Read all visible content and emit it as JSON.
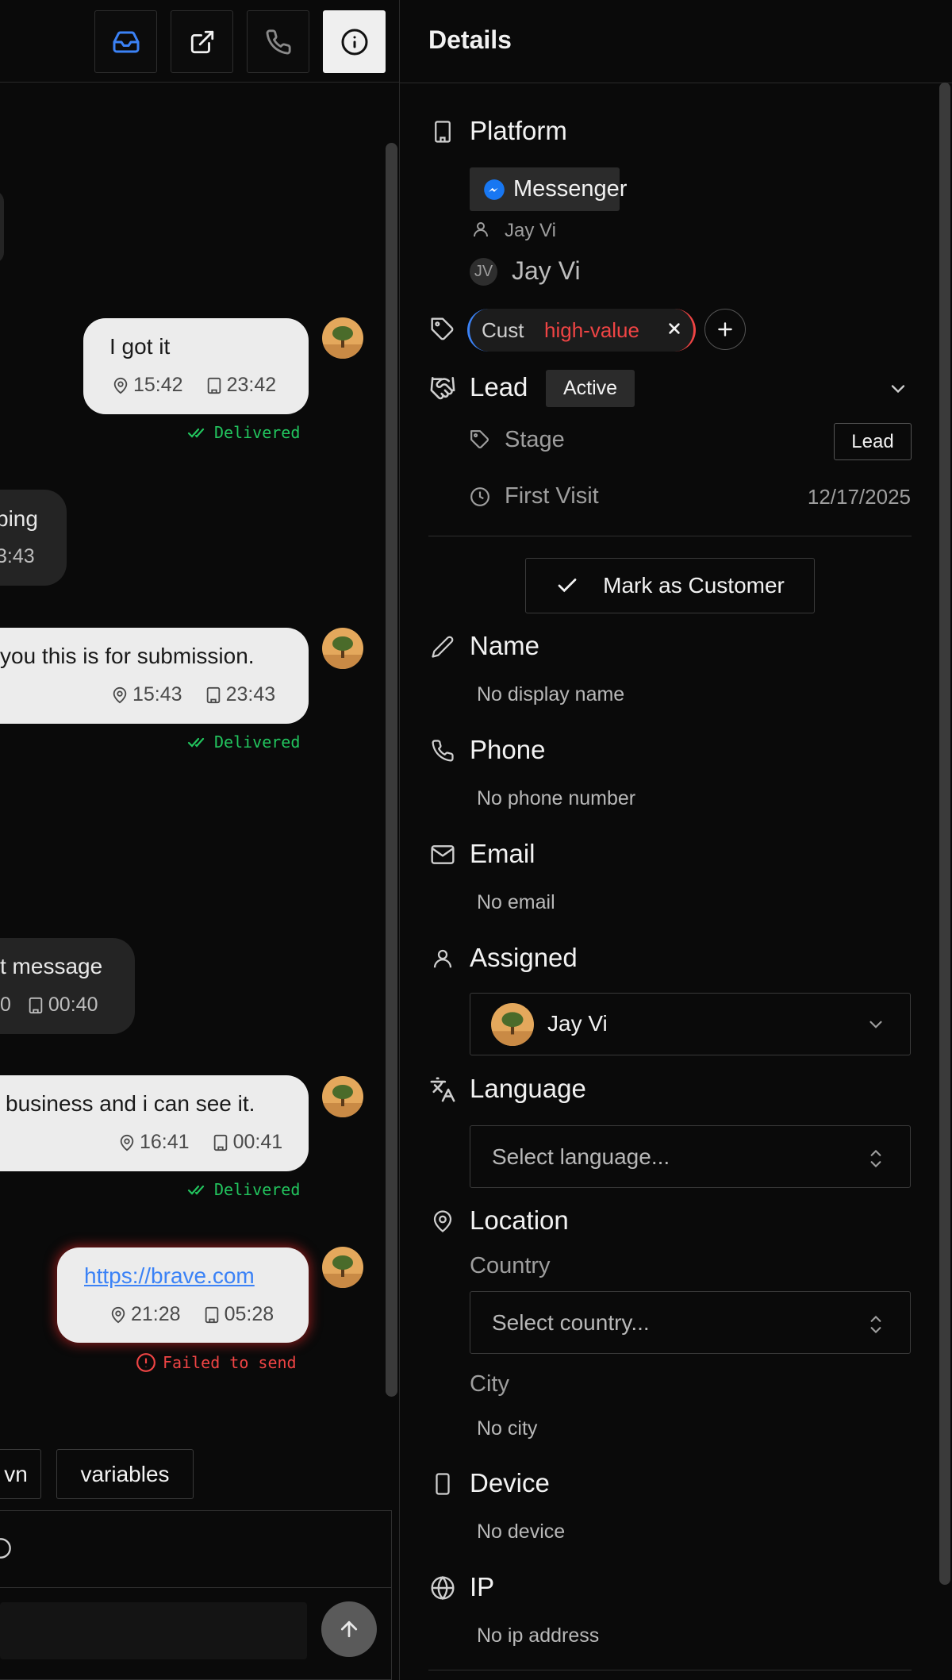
{
  "chat": {
    "header_buttons": [
      {
        "icon": "inbox-icon"
      },
      {
        "icon": "external-link-icon"
      },
      {
        "icon": "phone-icon"
      },
      {
        "icon": "info-icon"
      }
    ],
    "messages": [
      {
        "text": "I got it",
        "loc_time": "15:42",
        "biz_time": "23:42",
        "status": "Delivered"
      },
      {
        "text": "ping",
        "biz_time": "3:43"
      },
      {
        "text": "you this is for submission.",
        "loc_time": "15:43",
        "biz_time": "23:43",
        "status": "Delivered"
      },
      {
        "text": "t message",
        "loc_time": "0",
        "biz_time": "00:40"
      },
      {
        "text": "business and i can see it.",
        "loc_time": "16:41",
        "biz_time": "00:41",
        "status": "Delivered"
      },
      {
        "text": "https://brave.com",
        "loc_time": "21:28",
        "biz_time": "05:28",
        "status": "Failed to send"
      }
    ],
    "chips": [
      "vn",
      "variables"
    ]
  },
  "details": {
    "title": "Details",
    "platform": {
      "label": "Platform",
      "badge": "Messenger",
      "user_small": "Jay Vi",
      "initials": "JV",
      "user_name": "Jay Vi"
    },
    "tags": {
      "first": "Cust",
      "second": "high-value"
    },
    "lead": {
      "label": "Lead",
      "status": "Active",
      "stage_label": "Stage",
      "stage_value": "Lead",
      "first_visit_label": "First Visit",
      "first_visit_value": "12/17/2025"
    },
    "mark_customer": "Mark as Customer",
    "name": {
      "label": "Name",
      "value": "No display name"
    },
    "phone": {
      "label": "Phone",
      "value": "No phone number"
    },
    "email": {
      "label": "Email",
      "value": "No email"
    },
    "assigned": {
      "label": "Assigned",
      "value": "Jay Vi"
    },
    "language": {
      "label": "Language",
      "placeholder": "Select language..."
    },
    "location": {
      "label": "Location",
      "country_label": "Country",
      "country_placeholder": "Select country...",
      "city_label": "City",
      "city_value": "No city"
    },
    "device": {
      "label": "Device",
      "value": "No device"
    },
    "ip": {
      "label": "IP",
      "value": "No ip address"
    }
  },
  "colors": {
    "delivered": "#22c55e",
    "failed": "#ef4444",
    "messenger": "#1877f2",
    "tag_red": "#ef4444"
  }
}
